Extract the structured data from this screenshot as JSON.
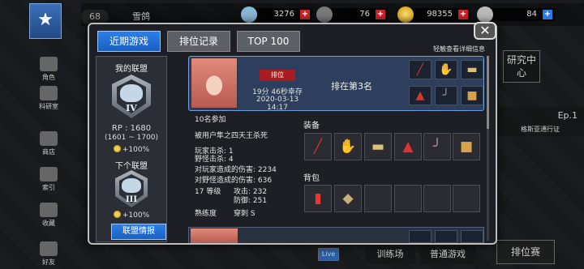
{
  "top_bar": {
    "player_level": "68",
    "player_name": "雪鸽",
    "resources": [
      {
        "icon": "energy-icon",
        "value": "3276"
      },
      {
        "icon": "ammo-icon",
        "value": "76"
      },
      {
        "icon": "gold-coin-icon",
        "value": "98355"
      },
      {
        "icon": "gem-icon",
        "value": "84"
      }
    ],
    "plus": "+"
  },
  "side_menu": [
    "角色",
    "科研室",
    "商店",
    "索引",
    "收藏",
    "好友"
  ],
  "background": {
    "research_center": "研究中心",
    "ep_label": "Ep.1",
    "pass_label": "格斯亚通行证",
    "training": "训练场",
    "normal_game": "普通游戏",
    "ranked_game": "排位赛",
    "live": "Live"
  },
  "tabs": [
    {
      "label": "近期游戏",
      "active": true
    },
    {
      "label": "排位记录",
      "active": false
    },
    {
      "label": "TOP 100",
      "active": false
    }
  ],
  "close_label": "✕",
  "detail_hint": "轻触查看详细信息",
  "league": {
    "my_league_title": "我的联盟",
    "current_tier_numeral": "IV",
    "rp": "RP : 1680",
    "rp_range": "(1601 ~ 1700)",
    "current_bonus": "+100%",
    "next_league_title": "下个联盟",
    "next_tier_numeral": "III",
    "next_bonus": "+100%",
    "info_button": "联盟情报"
  },
  "match": {
    "badge": "排位",
    "survive_time": "19分 46秒幸存",
    "date": "2020-03-13 14:17",
    "rank_text": "排在第3名",
    "item_icons": [
      "rifle-icon",
      "gauntlet-icon",
      "ammo-pack-icon",
      "jacket-icon",
      "boots-icon",
      "crate-icon"
    ]
  },
  "stats": {
    "participants": "10名参加",
    "killed_by": "被用户隼之四天王杀死",
    "player_kills": "玩家击杀: 1",
    "beast_kills": "野怪击杀: 4",
    "player_damage": "对玩家造成的伤害: 2234",
    "beast_damage": "对野怪造成的伤害: 636",
    "level": "17 等级",
    "attack": "攻击: 232",
    "defense": "防御: 251",
    "proficiency_label": "熟练度",
    "proficiency_value": "穿刺 S"
  },
  "equipment": {
    "label": "装备",
    "icons": [
      "sniper-rifle-icon",
      "glove-icon",
      "bullet-case-icon",
      "red-jacket-icon",
      "purple-boots-icon",
      "supply-box-icon"
    ]
  },
  "backpack": {
    "label": "背包",
    "icons": [
      "red-cartridge-icon",
      "fish-icon",
      "",
      "",
      "",
      ""
    ]
  }
}
